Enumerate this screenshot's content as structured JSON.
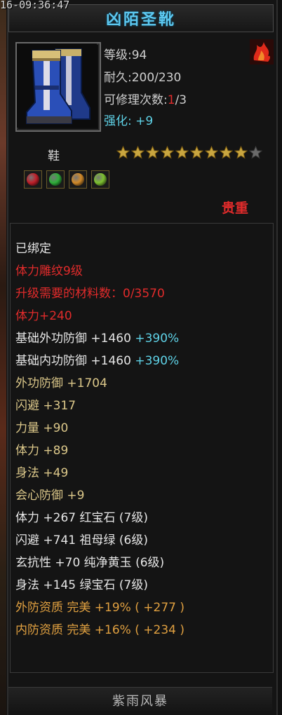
{
  "timestamp": "16-09:36:47",
  "title": "凶陌圣靴",
  "stats": {
    "level_label": "等级",
    "level_value": "94",
    "durability_label": "耐久",
    "durability_value": "200/230",
    "repair_label": "可修理次数",
    "repair_used": "1",
    "repair_total": "/3",
    "enhance_label": "强化",
    "enhance_value": "+9"
  },
  "slot_type": "鞋",
  "stars": {
    "filled": 9,
    "total": 10
  },
  "gems": [
    {
      "name": "red-gem-icon",
      "color": "#c0202a"
    },
    {
      "name": "green-gem-icon",
      "color": "#2fae3a"
    },
    {
      "name": "amber-gem-icon",
      "color": "#d08a2a"
    },
    {
      "name": "lime-gem-icon",
      "color": "#7dc030"
    }
  ],
  "rarity": "贵重",
  "properties": [
    {
      "text": "已绑定",
      "color": "white"
    },
    {
      "text": "体力雕纹9级",
      "color": "red"
    },
    {
      "text": "升级需要的材料数：0/3570",
      "color": "red"
    },
    {
      "text": "体力+240",
      "color": "red"
    },
    {
      "text": "基础外功防御  +1460",
      "extra": "+390%",
      "color": "white"
    },
    {
      "text": "基础内功防御  +1460",
      "extra": "+390%",
      "color": "white"
    },
    {
      "text": "外功防御 +1704",
      "color": "yellow"
    },
    {
      "text": "闪避 +317",
      "color": "yellow"
    },
    {
      "text": "力量 +90",
      "color": "yellow"
    },
    {
      "text": "体力 +89",
      "color": "yellow"
    },
    {
      "text": "身法 +49",
      "color": "yellow"
    },
    {
      "text": "会心防御 +9",
      "color": "yellow"
    },
    {
      "text": "体力 +267  红宝石 (7级)",
      "color": "white"
    },
    {
      "text": "闪避 +741  祖母绿 (6级)",
      "color": "white"
    },
    {
      "text": "玄抗性 +70  纯净黄玉 (6级)",
      "color": "white"
    },
    {
      "text": "身法 +145  绿宝石 (7级)",
      "color": "white"
    },
    {
      "text": "外防资质    完美  +19%  ( +277 )",
      "color": "orange"
    },
    {
      "text": "内防资质    完美  +16%  ( +234 )",
      "color": "orange"
    }
  ],
  "footer": "紫雨风暴",
  "colors": {
    "title": "#5cc8f0",
    "red": "#e12b2b",
    "cyan": "#5fd3e8",
    "yellow": "#dcc88a",
    "orange": "#e0a040",
    "white": "#e6e6e6"
  }
}
